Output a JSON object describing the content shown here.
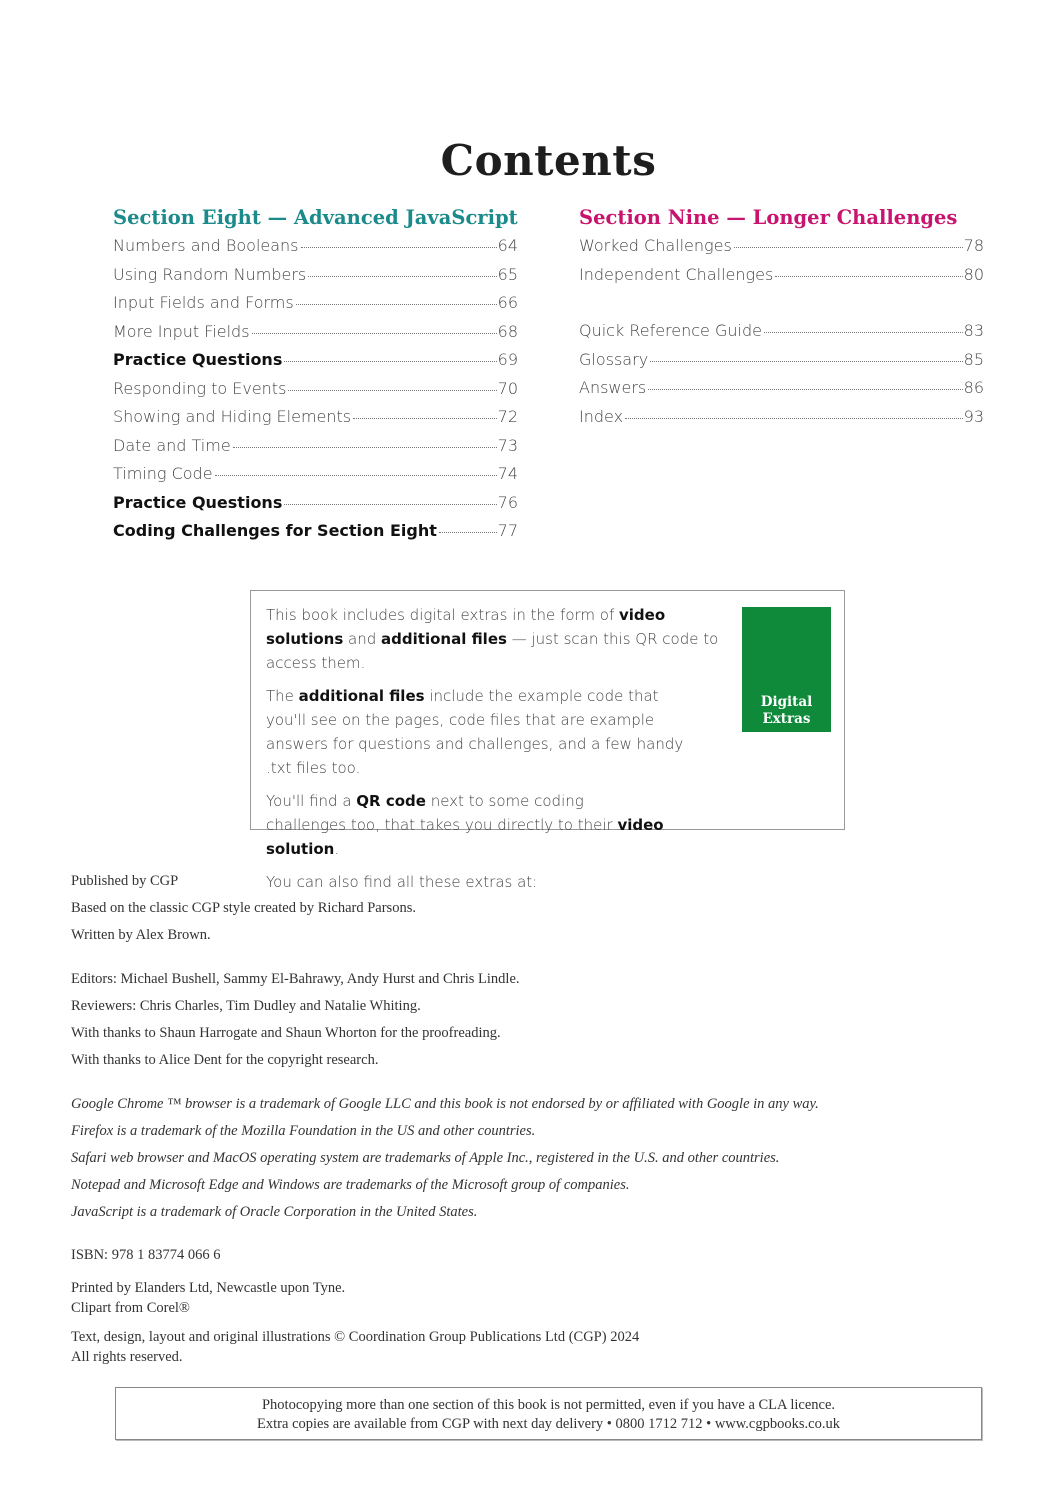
{
  "page": {
    "title": "Contents"
  },
  "colors": {
    "section_eight": "#1a8a8a",
    "section_nine": "#c8146e",
    "digital_extras_bg": "#0e8a3a"
  },
  "section_eight": {
    "heading": "Section Eight — Advanced JavaScript",
    "items": [
      {
        "title": "Numbers and Booleans",
        "page": "64",
        "bold": false
      },
      {
        "title": "Using Random Numbers",
        "page": "65",
        "bold": false
      },
      {
        "title": "Input Fields and Forms",
        "page": "66",
        "bold": false
      },
      {
        "title": "More Input Fields",
        "page": "68",
        "bold": false
      },
      {
        "title": "Practice Questions",
        "page": "69",
        "bold": true
      },
      {
        "title": "Responding to Events",
        "page": "70",
        "bold": false
      },
      {
        "title": "Showing and Hiding Elements",
        "page": "72",
        "bold": false
      },
      {
        "title": "Date and Time",
        "page": "73",
        "bold": false
      },
      {
        "title": "Timing Code",
        "page": "74",
        "bold": false
      },
      {
        "title": "Practice Questions",
        "page": "76",
        "bold": true
      },
      {
        "title": "Coding Challenges for Section Eight",
        "page": "77",
        "bold": true
      }
    ]
  },
  "section_nine": {
    "heading": "Section Nine — Longer Challenges",
    "items": [
      {
        "title": "Worked Challenges",
        "page": "78"
      },
      {
        "title": "Independent Challenges",
        "page": "80"
      }
    ],
    "extra_items": [
      {
        "title": "Quick Reference Guide",
        "page": "83"
      },
      {
        "title": "Glossary",
        "page": "85"
      },
      {
        "title": "Answers",
        "page": "86"
      },
      {
        "title": "Index",
        "page": "93"
      }
    ]
  },
  "digital_extras": {
    "p1_a": "This book includes digital extras in the form of ",
    "p1_b": "video solutions",
    "p1_c": " and ",
    "p1_d": "additional files",
    "p1_e": " — just scan this QR code to access them.",
    "p2_a": "The ",
    "p2_b": "additional files",
    "p2_c": " include the example code that you'll see on the pages, code files that are example answers for questions and challenges, and a few handy .txt files too.",
    "p3_a": "You'll find a ",
    "p3_b": "QR code",
    "p3_c": " next to some coding challenges too, that takes you directly to their ",
    "p3_d": "video solution",
    "p3_e": ".",
    "p4": "You can also find all these extras at:",
    "badge_line1": "Digital",
    "badge_line2": "Extras"
  },
  "credits": {
    "published": "Published by CGP",
    "based_on": "Based on the classic CGP style created by Richard Parsons.",
    "written_by": "Written by Alex Brown.",
    "editors": "Editors: Michael Bushell, Sammy El-Bahrawy, Andy Hurst and Chris Lindle.",
    "reviewers": "Reviewers: Chris Charles, Tim Dudley and Natalie Whiting.",
    "thanks_proofreading": "With thanks to Shaun Harrogate and Shaun Whorton for the proofreading.",
    "thanks_copyright": "With thanks to Alice Dent for the copyright research.",
    "trademarks": [
      "Google Chrome ™ browser is a trademark of  Google LLC and this book is not endorsed by or affiliated with Google in any way.",
      "Firefox is a trademark of  the Mozilla Foundation in the US and other countries.",
      "Safari web browser and MacOS operating system are trademarks of  Apple Inc., registered in the U.S. and other countries.",
      "Notepad and Microsoft Edge and Windows are trademarks of  the Microsoft group of  companies.",
      "JavaScript is a trademark of  Oracle Corporation in the United States."
    ],
    "isbn": "ISBN: 978 1 83774 066 6",
    "printed_by": "Printed by Elanders Ltd, Newcastle upon Tyne.",
    "clipart": "Clipart from Corel®",
    "copyright": "Text, design, layout and original illustrations  © Coordination Group Publications Ltd (CGP) 2024",
    "rights": "All rights reserved."
  },
  "footer": {
    "line1": "Photocopying more than one section of this book is not permitted, even if you have a CLA licence.",
    "line2": "Extra copies are available from CGP with next day delivery  •  0800 1712 712  •  www.cgpbooks.co.uk"
  }
}
